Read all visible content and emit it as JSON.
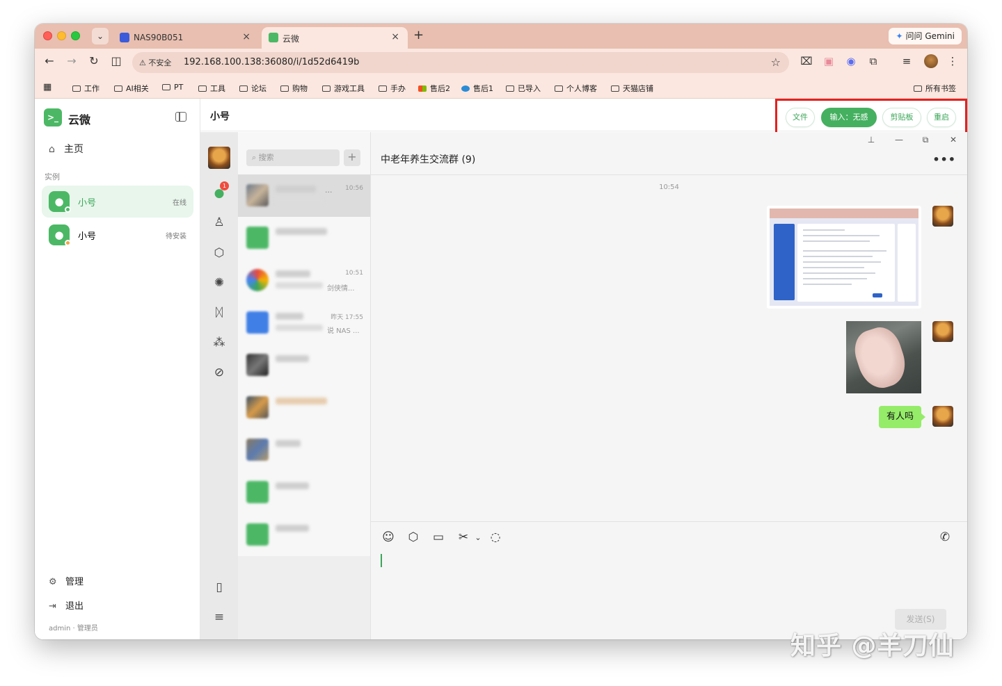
{
  "browser": {
    "tabs": [
      {
        "title": "NAS90B051",
        "favicon_color": "#3b5bdb"
      },
      {
        "title": "云微",
        "favicon_color": "#4cb865"
      }
    ],
    "new_tab": "+",
    "gemini": "问问 Gemini",
    "security": "不安全",
    "url": "192.168.100.138:36080/i/1d52d6419b",
    "bookmarks": [
      "工作",
      "AI相关",
      "PT",
      "工具",
      "论坛",
      "购物",
      "游戏工具",
      "手办",
      "售后2",
      "售后1",
      "已导入",
      "个人博客",
      "天猫店铺"
    ],
    "all_bookmarks": "所有书签"
  },
  "sidebar": {
    "app_name": "云微",
    "logo_text": ">_",
    "home": "主页",
    "section": "实例",
    "instances": [
      {
        "name": "小号",
        "status": "在线",
        "dot_color": "#4cb865"
      },
      {
        "name": "小号",
        "status": "待安装",
        "dot_color": "#f0a44b"
      }
    ],
    "manage": "管理",
    "logout": "退出",
    "footer": "admin · 管理员"
  },
  "header": {
    "title": "小号",
    "actions": {
      "file": "文件",
      "input": "输入：无感",
      "clipboard": "剪贴板",
      "restart": "重启"
    },
    "highlight_color": "#e5201d"
  },
  "wechat": {
    "badge": "1",
    "search_placeholder": "搜索",
    "add": "+",
    "chats": [
      {
        "time": "10:56",
        "preview": "",
        "title_end": "..."
      },
      {
        "time": "",
        "preview": "",
        "title_end": ""
      },
      {
        "time": "10:51",
        "preview": "剑侠情...",
        "title_end": ""
      },
      {
        "time": "昨天 17:55",
        "preview": "说 NAS ...",
        "title_end": ""
      },
      {
        "time": "",
        "preview": "",
        "title_end": ""
      },
      {
        "time": "",
        "preview": "",
        "title_end": ""
      },
      {
        "time": "",
        "preview": "",
        "title_end": ""
      },
      {
        "time": "",
        "preview": "",
        "title_end": ""
      },
      {
        "time": "",
        "preview": "",
        "title_end": ""
      }
    ],
    "conversation": {
      "title": "中老年养生交流群 (9)",
      "more": "•••",
      "time": "10:54",
      "text_message": "有人吗",
      "send_button": "发送(S)"
    }
  },
  "watermark": "知乎 @羊刀仙"
}
